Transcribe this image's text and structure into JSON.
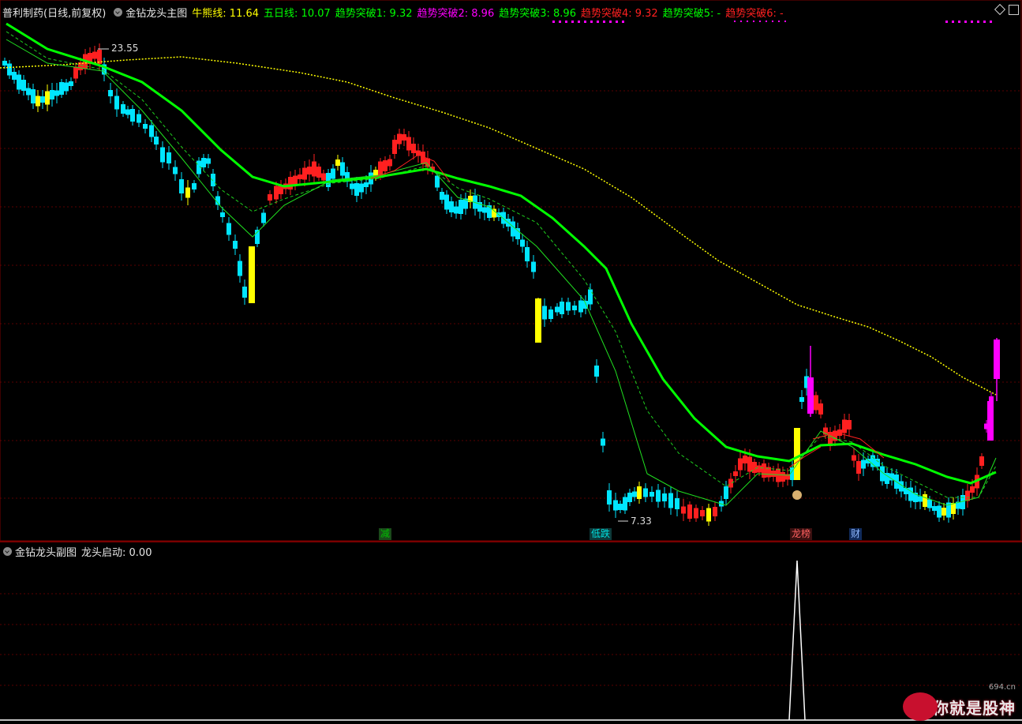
{
  "header": {
    "stock_name": "普利制药(日线,前复权)",
    "indicator_name": "金钻龙头主图",
    "lines": [
      {
        "label": "牛熊线: 11.64",
        "color": "#ffff00"
      },
      {
        "label": "五日线: 10.07",
        "color": "#00ff00"
      },
      {
        "label": "趋势突破1: 9.32",
        "color": "#00ff00"
      },
      {
        "label": "趋势突破2: 8.96",
        "color": "#ff00ff"
      },
      {
        "label": "趋势突破3: 8.96",
        "color": "#00ff00"
      },
      {
        "label": "趋势突破4: 9.32",
        "color": "#ff2020"
      },
      {
        "label": "趋势突破5: -",
        "color": "#00ff00"
      },
      {
        "label": "趋势突破6: -",
        "color": "#ff2020"
      }
    ]
  },
  "sub_header": {
    "indicator_name": "金钻龙头副图",
    "value_label": "龙头启动: 0.00"
  },
  "annotations": {
    "high_price": "23.55",
    "low_price": "7.33",
    "tags": [
      {
        "text": "减",
        "color": "#00c000",
        "bg": "#1a4a1a"
      },
      {
        "text": "低跌",
        "color": "#00e0e0",
        "bg": "#0d3a3a"
      },
      {
        "text": "龙榜",
        "color": "#ff6060",
        "bg": "#3a1010"
      },
      {
        "text": "财",
        "color": "#8fb8ff",
        "bg": "#102a5a"
      }
    ]
  },
  "watermark": {
    "text": "你就是股神",
    "small": "694.cn"
  },
  "colors": {
    "up": "#ff2020",
    "down": "#00e5ff",
    "special": "#ffff00",
    "limit": "#ff00ff",
    "ma_main": "#00ff00",
    "bull_bear": "#ffff00",
    "grid": "#5a0000"
  },
  "chart_data": {
    "type": "candlestick",
    "price_high": 23.55,
    "price_low": 7.33,
    "bull_bear_line_last": 11.64,
    "five_day_line_last": 10.07,
    "sub_indicator_peak": "single spike near day of 龙榜 tag"
  }
}
